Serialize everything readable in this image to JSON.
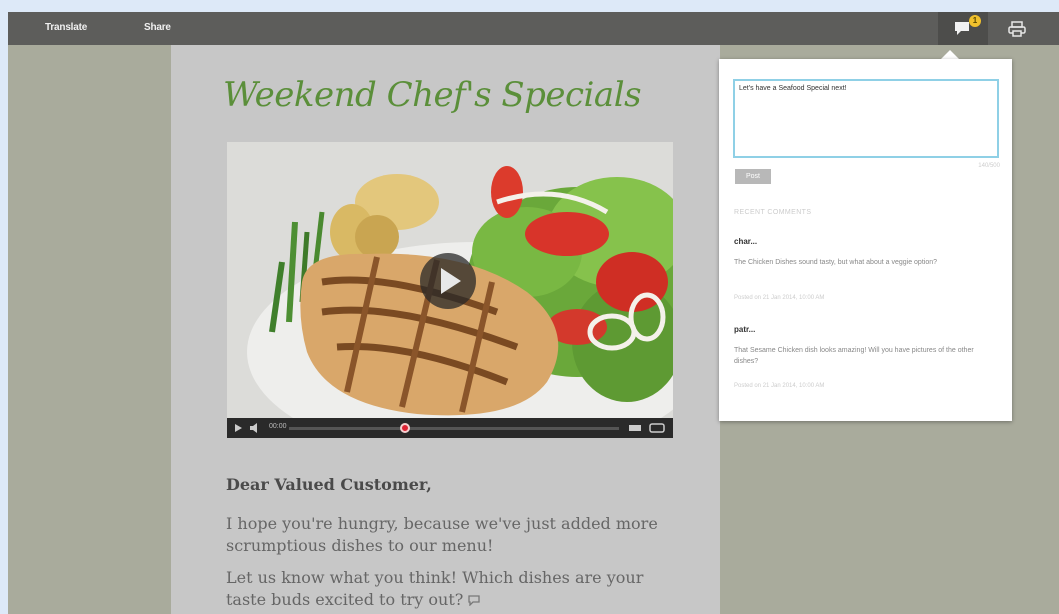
{
  "toolbar": {
    "translate_label": "Translate",
    "share_label": "Share",
    "comment_badge": "1",
    "comment_icon": "speech-bubble-icon",
    "print_icon": "printer-icon"
  },
  "email": {
    "headline": "Weekend Chef's Specials",
    "video": {
      "time": "00:00",
      "progress_fraction": 0.35
    },
    "greeting": "Dear Valued Customer,",
    "paragraph1": "I hope you're hungry, because we've just added more scrumptious dishes to our menu!",
    "paragraph2": "Let us know what you think! Which dishes are your taste buds excited to try out?"
  },
  "comments_popup": {
    "input_value": "Let's have a Seafood Special next!",
    "char_count": "140/500",
    "post_label": "Post",
    "recent_title": "RECENT COMMENTS",
    "comments": [
      {
        "author": "char...",
        "text": "The Chicken Dishes sound tasty, but what about a veggie option?",
        "meta": "Posted on 21 Jan 2014, 10:00 AM"
      },
      {
        "author": "patr...",
        "text": "That Sesame Chicken dish looks amazing! Will you have pictures of the other dishes?",
        "meta": "Posted on 21 Jan 2014, 10:00 AM"
      }
    ]
  },
  "colors": {
    "topbar": "#5d5d5b",
    "headline_green": "#5b8f3a",
    "badge_yellow": "#f1c12d",
    "input_focus": "#8fd0e6"
  }
}
